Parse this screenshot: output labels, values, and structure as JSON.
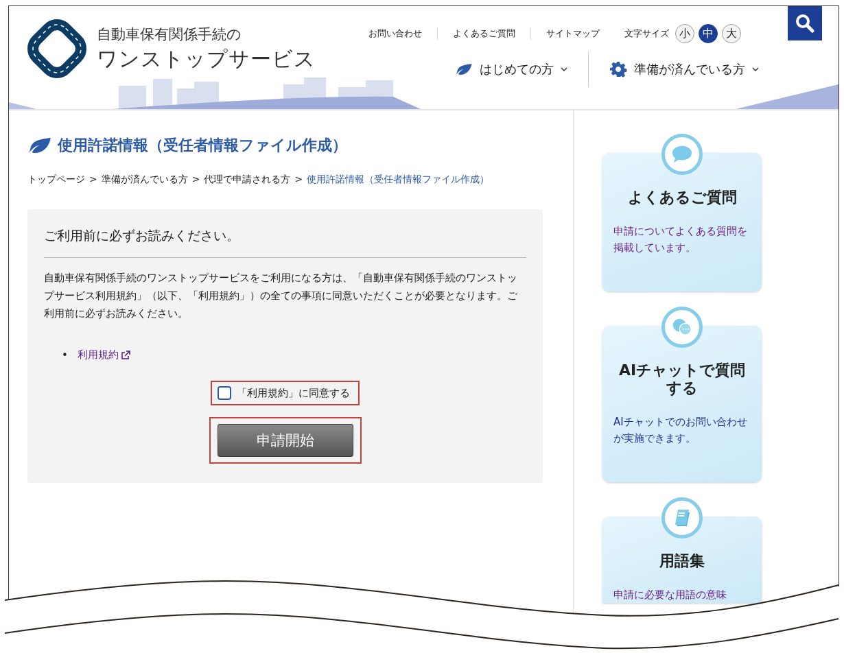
{
  "header": {
    "logo_line1": "自動車保有関係手続の",
    "logo_line2": "ワンストップサービス",
    "utility_links": [
      "お問い合わせ",
      "よくあるご質問",
      "サイトマップ"
    ],
    "text_size": {
      "label": "文字サイズ",
      "options": [
        {
          "label": "小",
          "selected": false
        },
        {
          "label": "中",
          "selected": true
        },
        {
          "label": "大",
          "selected": false
        }
      ]
    },
    "nav": [
      {
        "label": "はじめての方"
      },
      {
        "label": "準備が済んでいる方"
      }
    ]
  },
  "page_title": "使用許諾情報（受任者情報ファイル作成）",
  "breadcrumb": {
    "separator": ">",
    "items": [
      {
        "label": "トップページ",
        "current": false
      },
      {
        "label": "準備が済んでいる方",
        "current": false
      },
      {
        "label": "代理で申請される方",
        "current": false
      },
      {
        "label": "使用許諾情報（受任者情報ファイル作成）",
        "current": true
      }
    ]
  },
  "notice": {
    "heading": "ご利用前に必ずお読みください。",
    "body": "自動車保有関係手続のワンストップサービスをご利用になる方は、「自動車保有関係手続のワンストップサービス利用規約」（以下、「利用規約」）の全ての事項に同意いただくことが必要となります。ご利用前に必ずお読みください。",
    "bullet": "•",
    "links": [
      "利用規約"
    ],
    "agreement": {
      "label": "「利用規約」に同意する",
      "checked": false
    },
    "button": "申請開始"
  },
  "sidebar": [
    {
      "title": "よくあるご質問",
      "description": "申請についてよくある質問を掲載しています。",
      "visited": true
    },
    {
      "title": "AIチャットで質問する",
      "description": "AIチャットでのお問い合わせが実施できます。",
      "visited": false
    },
    {
      "title": "用語集",
      "description": "申請に必要な用語の意味",
      "visited": true
    }
  ]
}
